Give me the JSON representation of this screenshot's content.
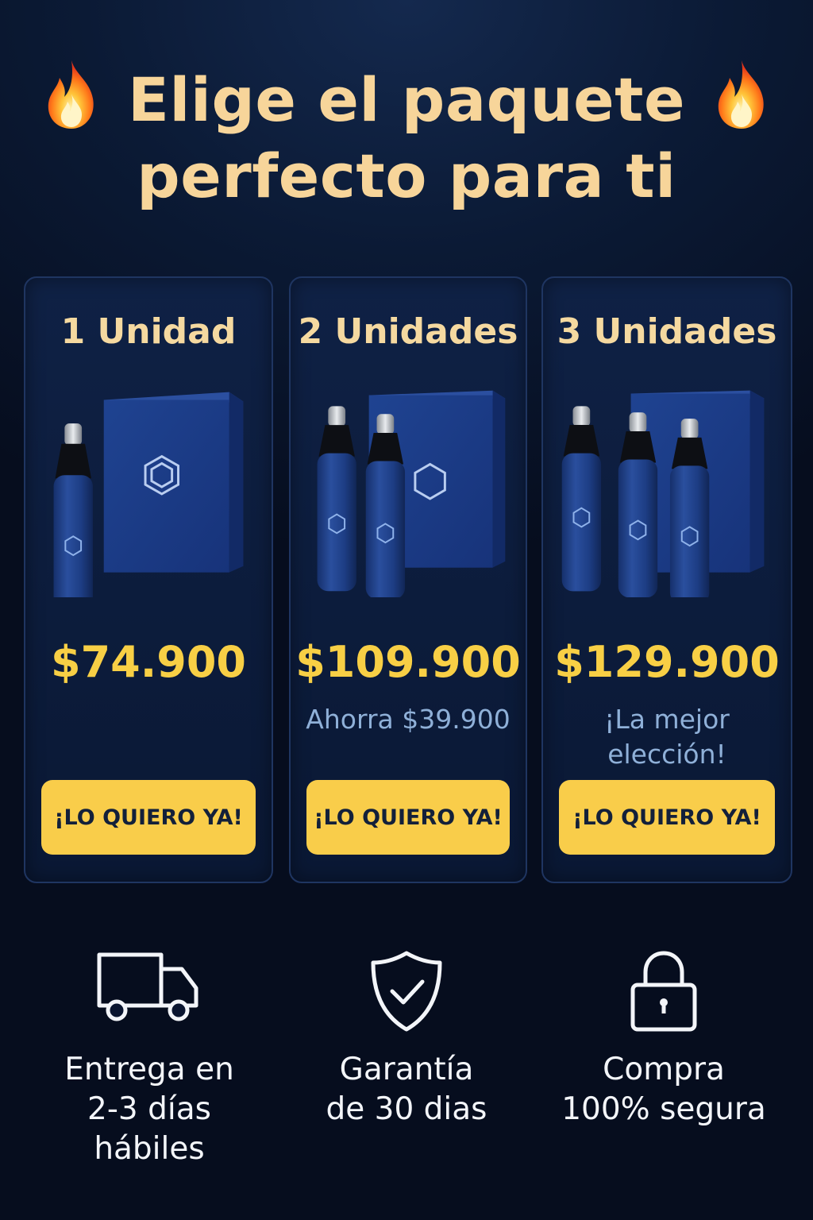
{
  "header": {
    "title_line1": "Elige el paquete",
    "title_line2": "perfecto para ti",
    "decor_icon": "fire-icon"
  },
  "packages": [
    {
      "title": "1 Unidad",
      "price": "$74.900",
      "note": "",
      "cta": "¡LO QUIERO YA!",
      "units": 1
    },
    {
      "title": "2 Unidades",
      "price": "$109.900",
      "note": "Ahorra $39.900",
      "cta": "¡LO QUIERO YA!",
      "units": 2
    },
    {
      "title": "3 Unidades",
      "price": "$129.900",
      "note": "¡La mejor elección!",
      "cta": "¡LO QUIERO YA!",
      "units": 3
    }
  ],
  "features": [
    {
      "icon": "delivery-truck-icon",
      "text": "Entrega en\n2-3 días\nhábiles"
    },
    {
      "icon": "shield-check-icon",
      "text": "Garantía\nde 30 dias"
    },
    {
      "icon": "padlock-icon",
      "text": "Compra\n100% segura"
    }
  ],
  "colors": {
    "background": "#0b1a35",
    "headline": "#f7d59a",
    "price": "#f8cf45",
    "button": "#f9cd4a",
    "note": "#8fb0d8",
    "product_blue": "#1e3f86"
  }
}
